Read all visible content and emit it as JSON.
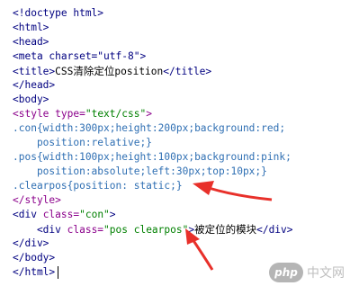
{
  "code": {
    "l1": "<!doctype html>",
    "l2": "<html>",
    "l3": "<head>",
    "l4": "<meta charset=\"utf-8\">",
    "l5_open": "<title>",
    "l5_css": "CSS",
    "l5_cjk": "清除定位",
    "l5_word": "position",
    "l5_close": "</title>",
    "l6": "</head>",
    "l7": "<body>",
    "l8_tag": "<style ",
    "l8_attr": "type=",
    "l8_str": "\"text/css\"",
    "l8_end": ">",
    "l9": ".con{width:300px;height:200px;background:red;",
    "l10": "    position:relative;}",
    "l11": ".pos{width:100px;height:100px;background:pink;",
    "l12": "    position:absolute;left:30px;top:10px;}",
    "l13": ".clearpos{position: static;}",
    "l14": "</style>",
    "l15_tag": "<div ",
    "l15_attr": "class=",
    "l15_str": "\"con\"",
    "l15_end": ">",
    "l16_tag": "    <div ",
    "l16_attr": "class=",
    "l16_str": "\"pos clearpos\"",
    "l16_end": ">",
    "l16_cjk": "被定位的模块",
    "l16_close": "</div>",
    "l17": "</div>",
    "l18": "</body>",
    "l19": "</html>"
  },
  "watermark": {
    "logo": "php",
    "text": "中文网"
  },
  "colors": {
    "tag": "#000080",
    "attribute": "#8b008b",
    "string": "#008000",
    "selector": "#2f6fb3",
    "arrow": "#e8302a"
  }
}
